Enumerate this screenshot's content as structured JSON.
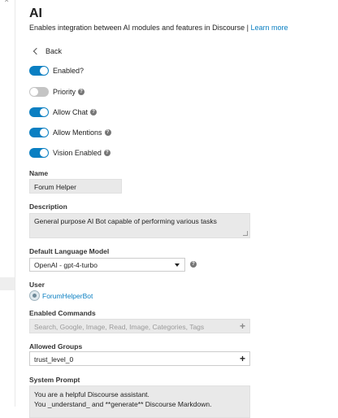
{
  "page": {
    "title": "AI",
    "subtitle": "Enables integration between AI modules and features in Discourse | ",
    "learn_more": "Learn more"
  },
  "back_label": "Back",
  "toggles": [
    {
      "label": "Enabled?",
      "on": true,
      "help": false
    },
    {
      "label": "Priority",
      "on": false,
      "help": true
    },
    {
      "label": "Allow Chat",
      "on": true,
      "help": true
    },
    {
      "label": "Allow Mentions",
      "on": true,
      "help": true
    },
    {
      "label": "Vision Enabled",
      "on": true,
      "help": true
    }
  ],
  "name": {
    "label": "Name",
    "value": "Forum Helper"
  },
  "description": {
    "label": "Description",
    "value": "General purpose AI Bot capable of performing various tasks"
  },
  "default_llm": {
    "label": "Default Language Model",
    "value": "OpenAI - gpt-4-turbo"
  },
  "user": {
    "label": "User",
    "value": "ForumHelperBot"
  },
  "enabled_commands": {
    "label": "Enabled Commands",
    "placeholder": "Search, Google, Image, Read, Image, Categories, Tags"
  },
  "allowed_groups": {
    "label": "Allowed Groups",
    "value": "trust_level_0"
  },
  "system_prompt": {
    "label": "System Prompt",
    "line1": "You are a helpful Discourse assistant.",
    "line2": "You _understand_ and **generate** Discourse Markdown."
  },
  "colors": {
    "accent": "#0a7fc2",
    "toggle_off": "#c4c4c4",
    "field_bg": "#e9e9e9"
  }
}
